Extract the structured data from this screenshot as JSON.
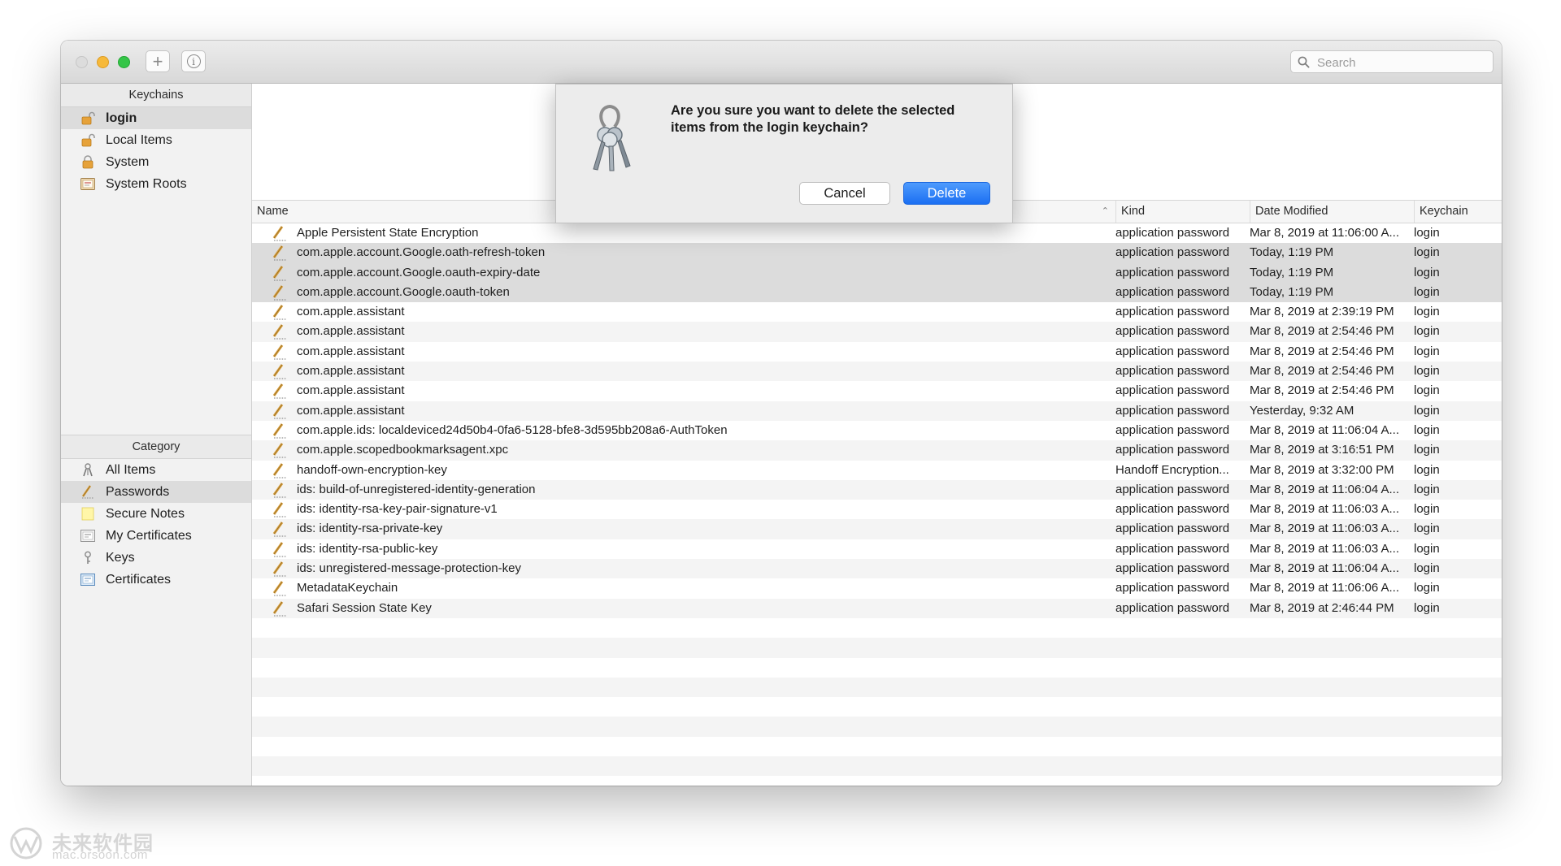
{
  "toolbar": {
    "add_label": "+",
    "info_label": "i",
    "search_placeholder": "Search"
  },
  "sidebar": {
    "keychains_header": "Keychains",
    "keychains": [
      {
        "label": "login",
        "icon": "unlocked-padlock-icon"
      },
      {
        "label": "Local Items",
        "icon": "unlocked-padlock-icon"
      },
      {
        "label": "System",
        "icon": "locked-padlock-icon"
      },
      {
        "label": "System Roots",
        "icon": "certificate-cabinet-icon"
      }
    ],
    "category_header": "Category",
    "categories": [
      {
        "label": "All Items",
        "icon": "keys-icon"
      },
      {
        "label": "Passwords",
        "icon": "pencil-icon"
      },
      {
        "label": "Secure Notes",
        "icon": "note-icon"
      },
      {
        "label": "My Certificates",
        "icon": "certificate-icon"
      },
      {
        "label": "Keys",
        "icon": "key-icon"
      },
      {
        "label": "Certificates",
        "icon": "certificate-icon"
      }
    ]
  },
  "table": {
    "columns": {
      "name": "Name",
      "kind": "Kind",
      "date": "Date Modified",
      "keychain": "Keychain"
    },
    "rows": [
      {
        "name": "Apple Persistent State Encryption",
        "kind": "application password",
        "date": "Mar 8, 2019 at 11:06:00 A...",
        "keychain": "login"
      },
      {
        "name": "com.apple.account.Google.oath-refresh-token",
        "kind": "application password",
        "date": "Today, 1:19 PM",
        "keychain": "login"
      },
      {
        "name": "com.apple.account.Google.oauth-expiry-date",
        "kind": "application password",
        "date": "Today, 1:19 PM",
        "keychain": "login"
      },
      {
        "name": "com.apple.account.Google.oauth-token",
        "kind": "application password",
        "date": "Today, 1:19 PM",
        "keychain": "login"
      },
      {
        "name": "com.apple.assistant",
        "kind": "application password",
        "date": "Mar 8, 2019 at 2:39:19 PM",
        "keychain": "login"
      },
      {
        "name": "com.apple.assistant",
        "kind": "application password",
        "date": "Mar 8, 2019 at 2:54:46 PM",
        "keychain": "login"
      },
      {
        "name": "com.apple.assistant",
        "kind": "application password",
        "date": "Mar 8, 2019 at 2:54:46 PM",
        "keychain": "login"
      },
      {
        "name": "com.apple.assistant",
        "kind": "application password",
        "date": "Mar 8, 2019 at 2:54:46 PM",
        "keychain": "login"
      },
      {
        "name": "com.apple.assistant",
        "kind": "application password",
        "date": "Mar 8, 2019 at 2:54:46 PM",
        "keychain": "login"
      },
      {
        "name": "com.apple.assistant",
        "kind": "application password",
        "date": "Yesterday, 9:32 AM",
        "keychain": "login"
      },
      {
        "name": "com.apple.ids: localdeviced24d50b4-0fa6-5128-bfe8-3d595bb208a6-AuthToken",
        "kind": "application password",
        "date": "Mar 8, 2019 at 11:06:04 A...",
        "keychain": "login"
      },
      {
        "name": "com.apple.scopedbookmarksagent.xpc",
        "kind": "application password",
        "date": "Mar 8, 2019 at 3:16:51 PM",
        "keychain": "login"
      },
      {
        "name": "handoff-own-encryption-key",
        "kind": "Handoff Encryption...",
        "date": "Mar 8, 2019 at 3:32:00 PM",
        "keychain": "login"
      },
      {
        "name": "ids: build-of-unregistered-identity-generation",
        "kind": "application password",
        "date": "Mar 8, 2019 at 11:06:04 A...",
        "keychain": "login"
      },
      {
        "name": "ids: identity-rsa-key-pair-signature-v1",
        "kind": "application password",
        "date": "Mar 8, 2019 at 11:06:03 A...",
        "keychain": "login"
      },
      {
        "name": "ids: identity-rsa-private-key",
        "kind": "application password",
        "date": "Mar 8, 2019 at 11:06:03 A...",
        "keychain": "login"
      },
      {
        "name": "ids: identity-rsa-public-key",
        "kind": "application password",
        "date": "Mar 8, 2019 at 11:06:03 A...",
        "keychain": "login"
      },
      {
        "name": "ids: unregistered-message-protection-key",
        "kind": "application password",
        "date": "Mar 8, 2019 at 11:06:04 A...",
        "keychain": "login"
      },
      {
        "name": "MetadataKeychain",
        "kind": "application password",
        "date": "Mar 8, 2019 at 11:06:06 A...",
        "keychain": "login"
      },
      {
        "name": "Safari Session State Key",
        "kind": "application password",
        "date": "Mar 8, 2019 at 2:46:44 PM",
        "keychain": "login"
      }
    ]
  },
  "dialog": {
    "message": "Are you sure you want to delete the selected items from the login keychain?",
    "cancel_label": "Cancel",
    "delete_label": "Delete",
    "icon": "keychain-keys-icon"
  },
  "watermark": {
    "text": "未来软件园",
    "url": "mac.orsoon.com"
  },
  "colors": {
    "accent": "#1b6ff2",
    "selection": "#dcdcdc",
    "close_dot": "#dcdcdc",
    "minimize_dot": "#f6b93a",
    "zoom_dot": "#35c548"
  }
}
